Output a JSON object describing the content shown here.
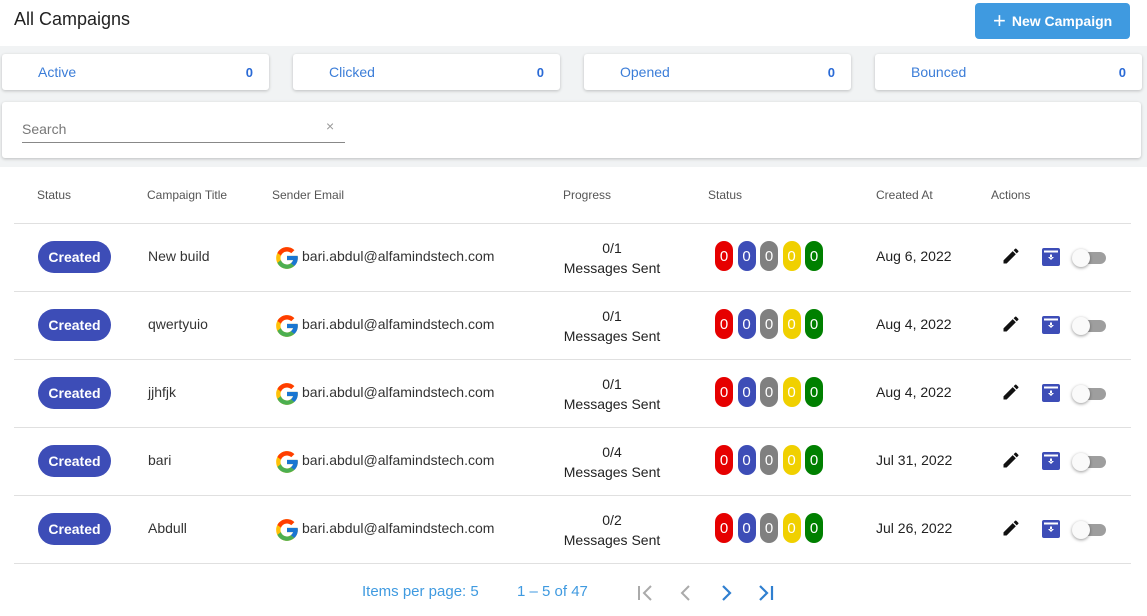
{
  "header": {
    "title": "All Campaigns",
    "new_button": "New Campaign"
  },
  "stats": [
    {
      "label": "Active",
      "count": "0"
    },
    {
      "label": "Clicked",
      "count": "0"
    },
    {
      "label": "Opened",
      "count": "0"
    },
    {
      "label": "Bounced",
      "count": "0"
    }
  ],
  "search": {
    "placeholder": "Search",
    "value": "",
    "clear": "×"
  },
  "table": {
    "columns": [
      "Status",
      "Campaign Title",
      "Sender Email",
      "Progress",
      "Status",
      "Created At",
      "Actions"
    ],
    "status_colors": [
      "#e60000",
      "#3d4db7",
      "#808080",
      "#f0d000",
      "#008000"
    ],
    "rows": [
      {
        "status": "Created",
        "title": "New build",
        "email": "bari.abdul@alfamindstech.com",
        "progress": "0/1",
        "progress_label": "Messages Sent",
        "counts": [
          "0",
          "0",
          "0",
          "0",
          "0"
        ],
        "created": "Aug 6, 2022"
      },
      {
        "status": "Created",
        "title": "qwertyuio",
        "email": "bari.abdul@alfamindstech.com",
        "progress": "0/1",
        "progress_label": "Messages Sent",
        "counts": [
          "0",
          "0",
          "0",
          "0",
          "0"
        ],
        "created": "Aug 4, 2022"
      },
      {
        "status": "Created",
        "title": "jjhfjk",
        "email": "bari.abdul@alfamindstech.com",
        "progress": "0/1",
        "progress_label": "Messages Sent",
        "counts": [
          "0",
          "0",
          "0",
          "0",
          "0"
        ],
        "created": "Aug 4, 2022"
      },
      {
        "status": "Created",
        "title": "bari",
        "email": "bari.abdul@alfamindstech.com",
        "progress": "0/4",
        "progress_label": "Messages Sent",
        "counts": [
          "0",
          "0",
          "0",
          "0",
          "0"
        ],
        "created": "Jul 31, 2022"
      },
      {
        "status": "Created",
        "title": "Abdull",
        "email": "bari.abdul@alfamindstech.com",
        "progress": "0/2",
        "progress_label": "Messages Sent",
        "counts": [
          "0",
          "0",
          "0",
          "0",
          "0"
        ],
        "created": "Jul 26, 2022"
      }
    ]
  },
  "pagination": {
    "items_per_page": "Items per page: 5",
    "range": "1 – 5 of 47"
  }
}
